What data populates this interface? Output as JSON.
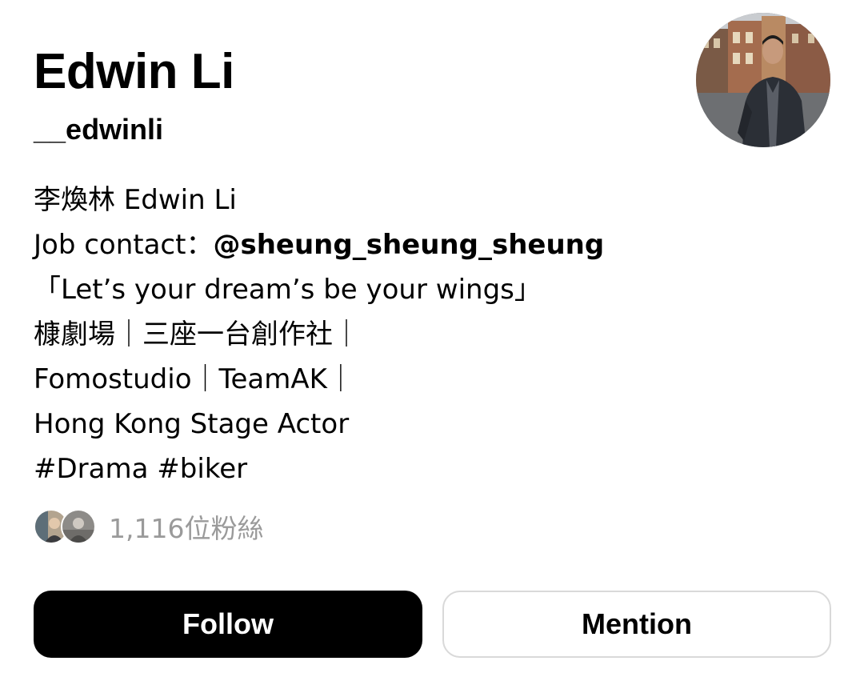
{
  "profile": {
    "display_name": "Edwin Li",
    "username": "__edwinli",
    "avatar_icon": "profile-photo"
  },
  "bio": {
    "line1": "李煥林 Edwin Li",
    "line2_prefix": "Job contact：",
    "line2_mention": "@sheung_sheung_sheung",
    "line3": "「Let’s your dream’s be your wings」",
    "line4": "槺劇場｜三座一台創作社｜",
    "line5": "Fomostudio｜TeamAK｜",
    "line6": "Hong Kong Stage Actor",
    "line7": "#Drama #biker"
  },
  "followers": {
    "count_label": "1,116位粉絲"
  },
  "actions": {
    "follow_label": "Follow",
    "mention_label": "Mention"
  },
  "colors": {
    "follow_bg": "#000000",
    "follow_text": "#ffffff",
    "mention_border": "#d9d9d9",
    "muted_text": "#9a9a9a"
  }
}
